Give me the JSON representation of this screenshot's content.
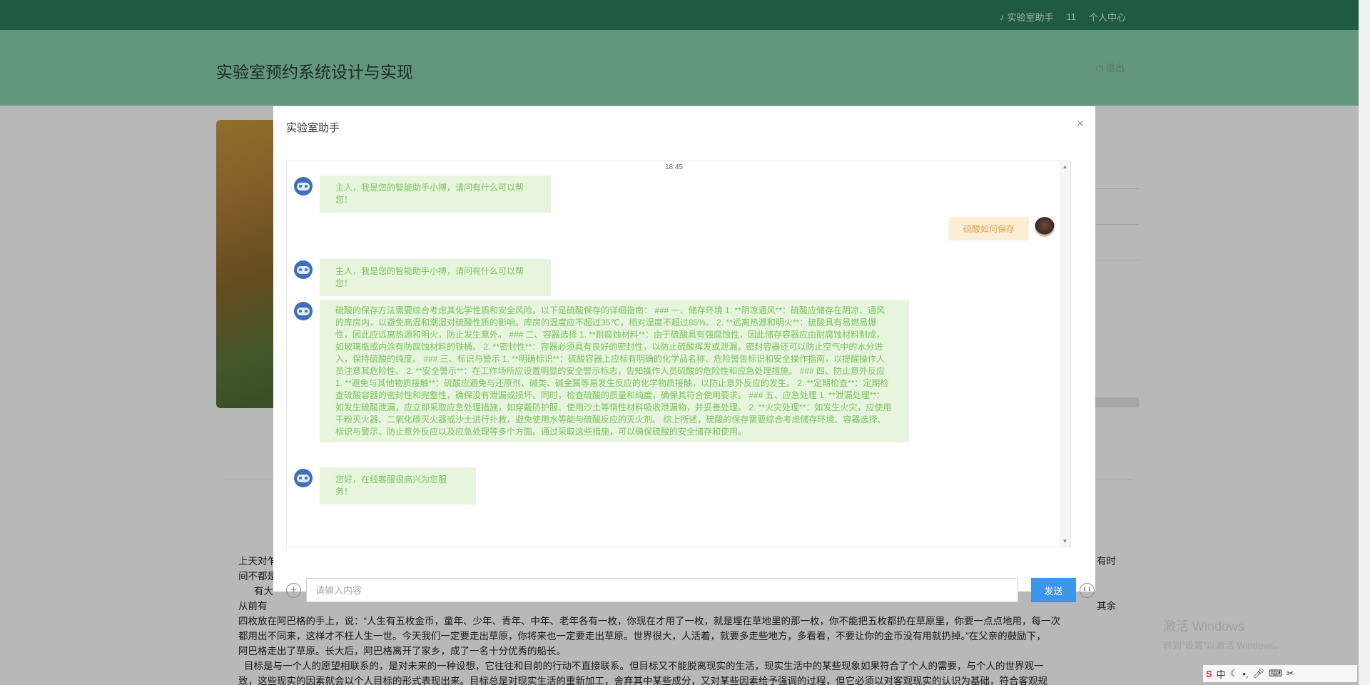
{
  "topbar": {
    "assistant_link": "实验室助手",
    "count": "11",
    "profile_link": "个人中心"
  },
  "header": {
    "site_title": "实验室预约系统设计与实现",
    "logout": "退出"
  },
  "article": {
    "lines": [
      "上天对乍",
      "间不都是",
      "有大",
      "从前有",
      "四枚放在阿巴格的手上，说：“人生有五枚金币，童年、少年、青年、中年、老年各有一枚，你现在才用了一枚，就是埋在草地里的那一枚，你不能把五枚都扔在草原里，你要一点点地用，每一次",
      "都用出不同来，这样才不枉人生一世。今天我们一定要走出草原，你将来也一定要走出草原。世界很大，人活着，就要多走些地方，多看看，不要让你的金币没有用就扔掉。”在父亲的鼓励下，",
      "阿巴格走出了草原。长大后，阿巴格离开了家乡，成了一名十分优秀的船长。",
      "目标是与一个人的愿望相联系的，是对未来的一种设想，它往往和目前的行动不直接联系。但目标又不能脱离现实的生活，现实生活中的某些现象如果符合了个人的需要，与个人的世界观一",
      "致，这些现实的因素就会以个人目标的形式表现出来。目标总是对现实生活的重新加工，舍弃其中某些成分，又对某些因素给予强调的过程，但它必须以对客观现实的认识为基础，符合客观规"
    ],
    "right_note_1": "有时",
    "right_note_2": "其余"
  },
  "modal": {
    "title": "实验室助手",
    "close": "×",
    "timestamp": "18:45",
    "messages": [
      {
        "from": "bot",
        "text": "主人，我是您的智能助手小搏，请问有什么可以帮您！"
      },
      {
        "from": "user",
        "text": "硫酸如何保存"
      },
      {
        "from": "bot",
        "text": "主人，我是您的智能助手小搏，请问有什么可以帮您！"
      },
      {
        "from": "bot",
        "text": "硫酸的保存方法需要综合考虑其化学性质和安全风险。以下是硫酸保存的详细指南： ### 一、储存环境 1. **阴凉通风**：硫酸应储存在阴凉、通风的库房内，以避免高温和潮湿对硫酸性质的影响。库房的温度应不超过35℃，相对湿度不超过85%。 2. **远离热源和明火**：硫酸具有易燃易爆性，因此应远离热源和明火，防止发生意外。 ### 二、容器选择 1. **耐腐蚀材料**：由于硫酸具有强腐蚀性，因此储存容器应由耐腐蚀材料制成，如玻璃瓶或内涂有防腐蚀材料的铁桶。 2. **密封性**：容器必须具有良好的密封性，以防止硫酸挥发或泄漏。密封容器还可以防止空气中的水分进入，保持硫酸的纯度。 ### 三、标识与警示 1. **明确标识**：硫酸容器上应标有明确的化学品名称、危险警告标识和安全操作指南，以提醒操作人员注意其危险性。 2. **安全警示**：在工作场所应设置明显的安全警示标志，告知操作人员硫酸的危险性和应急处理措施。 ### 四、防止意外反应 1. **避免与其他物质接触**：硫酸应避免与还原剂、碱类、碱金属等易发生反应的化学物质接触，以防止意外反应的发生。 2. **定期检查**：定期检查硫酸容器的密封性和完整性，确保没有泄漏或损坏。同时，检查硫酸的质量和纯度，确保其符合使用要求。 ### 五、应急处理 1. **泄漏处理**：如发生硫酸泄漏，应立即采取应急处理措施，如穿戴防护服、使用沙土等惰性材料吸收泄漏物，并妥善处理。 2. **火灾处理**：如发生火灾，应使用干粉灭火器、二氧化碳灭火器或沙土进行扑救，避免使用水等能与硫酸反应的灭火剂。 综上所述，硫酸的保存需要综合考虑储存环境、容器选择、标识与警示、防止意外反应以及应急处理等多个方面。通过采取这些措施，可以确保硫酸的安全储存和使用。"
      },
      {
        "from": "bot",
        "text": "您好，在线客服很高兴为您服务！"
      }
    ],
    "input_placeholder": "请输入内容",
    "send_label": "发送"
  },
  "windows_watermark": {
    "line1": "激活 Windows",
    "line2": "转到“设置”以激活 Windows。"
  },
  "taskbar": {
    "ime": "中"
  }
}
